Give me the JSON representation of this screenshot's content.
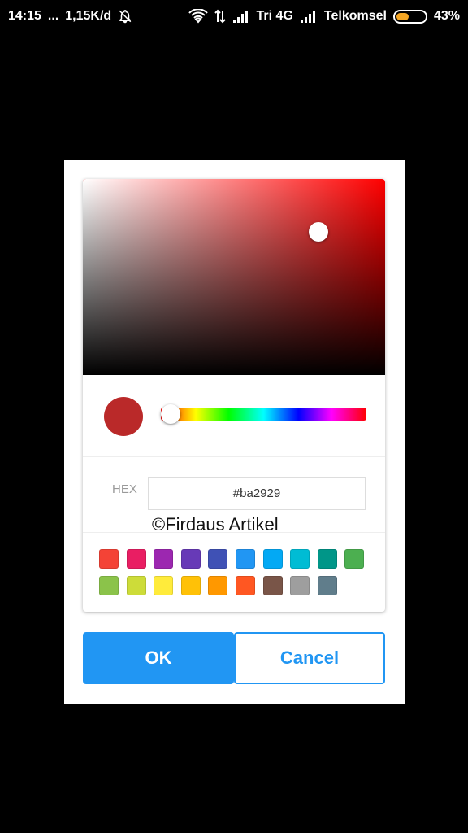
{
  "status_bar": {
    "time": "14:15",
    "dots": "...",
    "net_speed": "1,15K/d",
    "carrier1": "Tri 4G",
    "carrier2": "Telkomsel",
    "battery_percent": "43%",
    "battery_level": 0.43,
    "icons": [
      "bell-off-icon",
      "wifi-icon",
      "data-transfer-icon",
      "signal-icon",
      "signal-icon"
    ]
  },
  "picker": {
    "hue_color": "#ff0000",
    "selected_color": "#ba2929",
    "hue_fraction": 0.0,
    "saturation": 0.78,
    "value": 0.73
  },
  "hex": {
    "label": "HEX",
    "value": "#ba2929"
  },
  "watermark": "©Firdaus Artikel",
  "swatches": [
    "#f44336",
    "#e91e63",
    "#9c27b0",
    "#673ab7",
    "#3f51b5",
    "#2196f3",
    "#03a9f4",
    "#00bcd4",
    "#009688",
    "#4caf50",
    "#8bc34a",
    "#cddc39",
    "#ffeb3b",
    "#ffc107",
    "#ff9800",
    "#ff5722",
    "#795548",
    "#9e9e9e",
    "#607d8b"
  ],
  "buttons": {
    "ok_label": "OK",
    "cancel_label": "Cancel",
    "accent": "#2196f3"
  }
}
